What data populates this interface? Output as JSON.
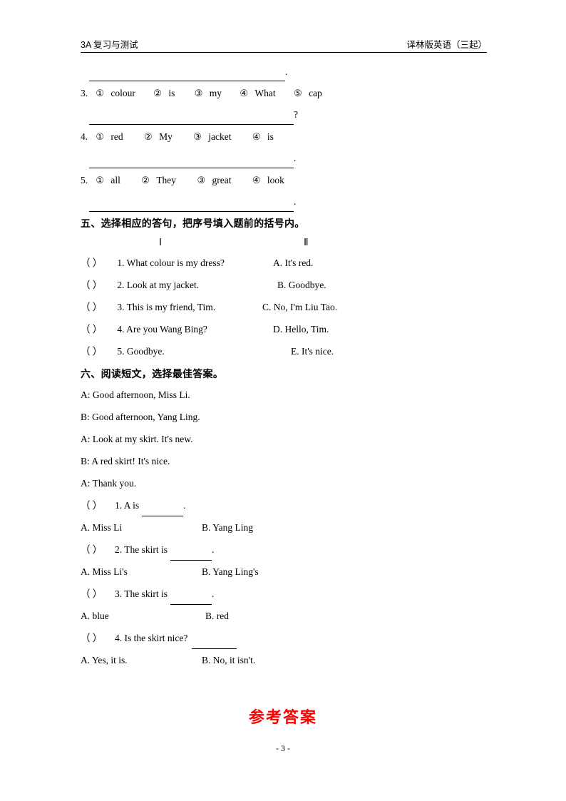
{
  "header": {
    "left": "3A 复习与测试",
    "right": "译林版英语（三起）"
  },
  "rearrange": {
    "items": [
      {
        "number": "3.",
        "words": [
          "colour",
          "is",
          "my",
          "What",
          "cap"
        ],
        "marks": [
          "①",
          "②",
          "③",
          "④",
          "⑤"
        ],
        "end": "?"
      },
      {
        "number": "4.",
        "words": [
          "red",
          "My",
          "jacket",
          "is"
        ],
        "marks": [
          "①",
          "②",
          "③",
          "④"
        ],
        "end": "."
      },
      {
        "number": "5.",
        "words": [
          "all",
          "They",
          "great",
          "look"
        ],
        "marks": [
          "①",
          "②",
          "③",
          "④"
        ],
        "end": "."
      }
    ],
    "first_answer_end": "."
  },
  "section_five": {
    "heading": "五、选择相应的答句，把序号填入题前的括号内。",
    "col_head_1": "Ⅰ",
    "col_head_2": "Ⅱ",
    "left_items": [
      "1. What colour is my dress?",
      "2. Look at my jacket.",
      "3. This is my friend, Tim.",
      "4. Are you Wang Bing?",
      "5. Goodbye."
    ],
    "right_items": [
      "A. It's red.",
      "B. Goodbye.",
      "C. No, I'm Liu Tao.",
      "D. Hello, Tim.",
      "E. It's nice."
    ],
    "paren": "（        ）"
  },
  "section_six": {
    "heading": "六、阅读短文，选择最佳答案。",
    "dialogue": [
      "A: Good afternoon, Miss Li.",
      "B: Good afternoon, Yang Ling.",
      "A: Look at my skirt. It's new.",
      "B: A red skirt! It's nice.",
      "A: Thank you."
    ],
    "questions": [
      {
        "stem": "1. A is",
        "tail": ".",
        "optionA": "A. Miss Li",
        "optionB": "B. Yang Ling"
      },
      {
        "stem": "2. The skirt is",
        "tail": ".",
        "optionA": "A. Miss Li's",
        "optionB": "B. Yang Ling's"
      },
      {
        "stem": "3. The skirt is",
        "tail": ".",
        "optionA": "A. blue",
        "optionB": "B. red"
      },
      {
        "stem": "4. Is the skirt nice?",
        "tail": "",
        "optionA": "A. Yes, it is.",
        "optionB": "B. No, it isn't."
      }
    ],
    "paren": "（        ）"
  },
  "answer_title": "参考答案",
  "footer": "- 3 -"
}
